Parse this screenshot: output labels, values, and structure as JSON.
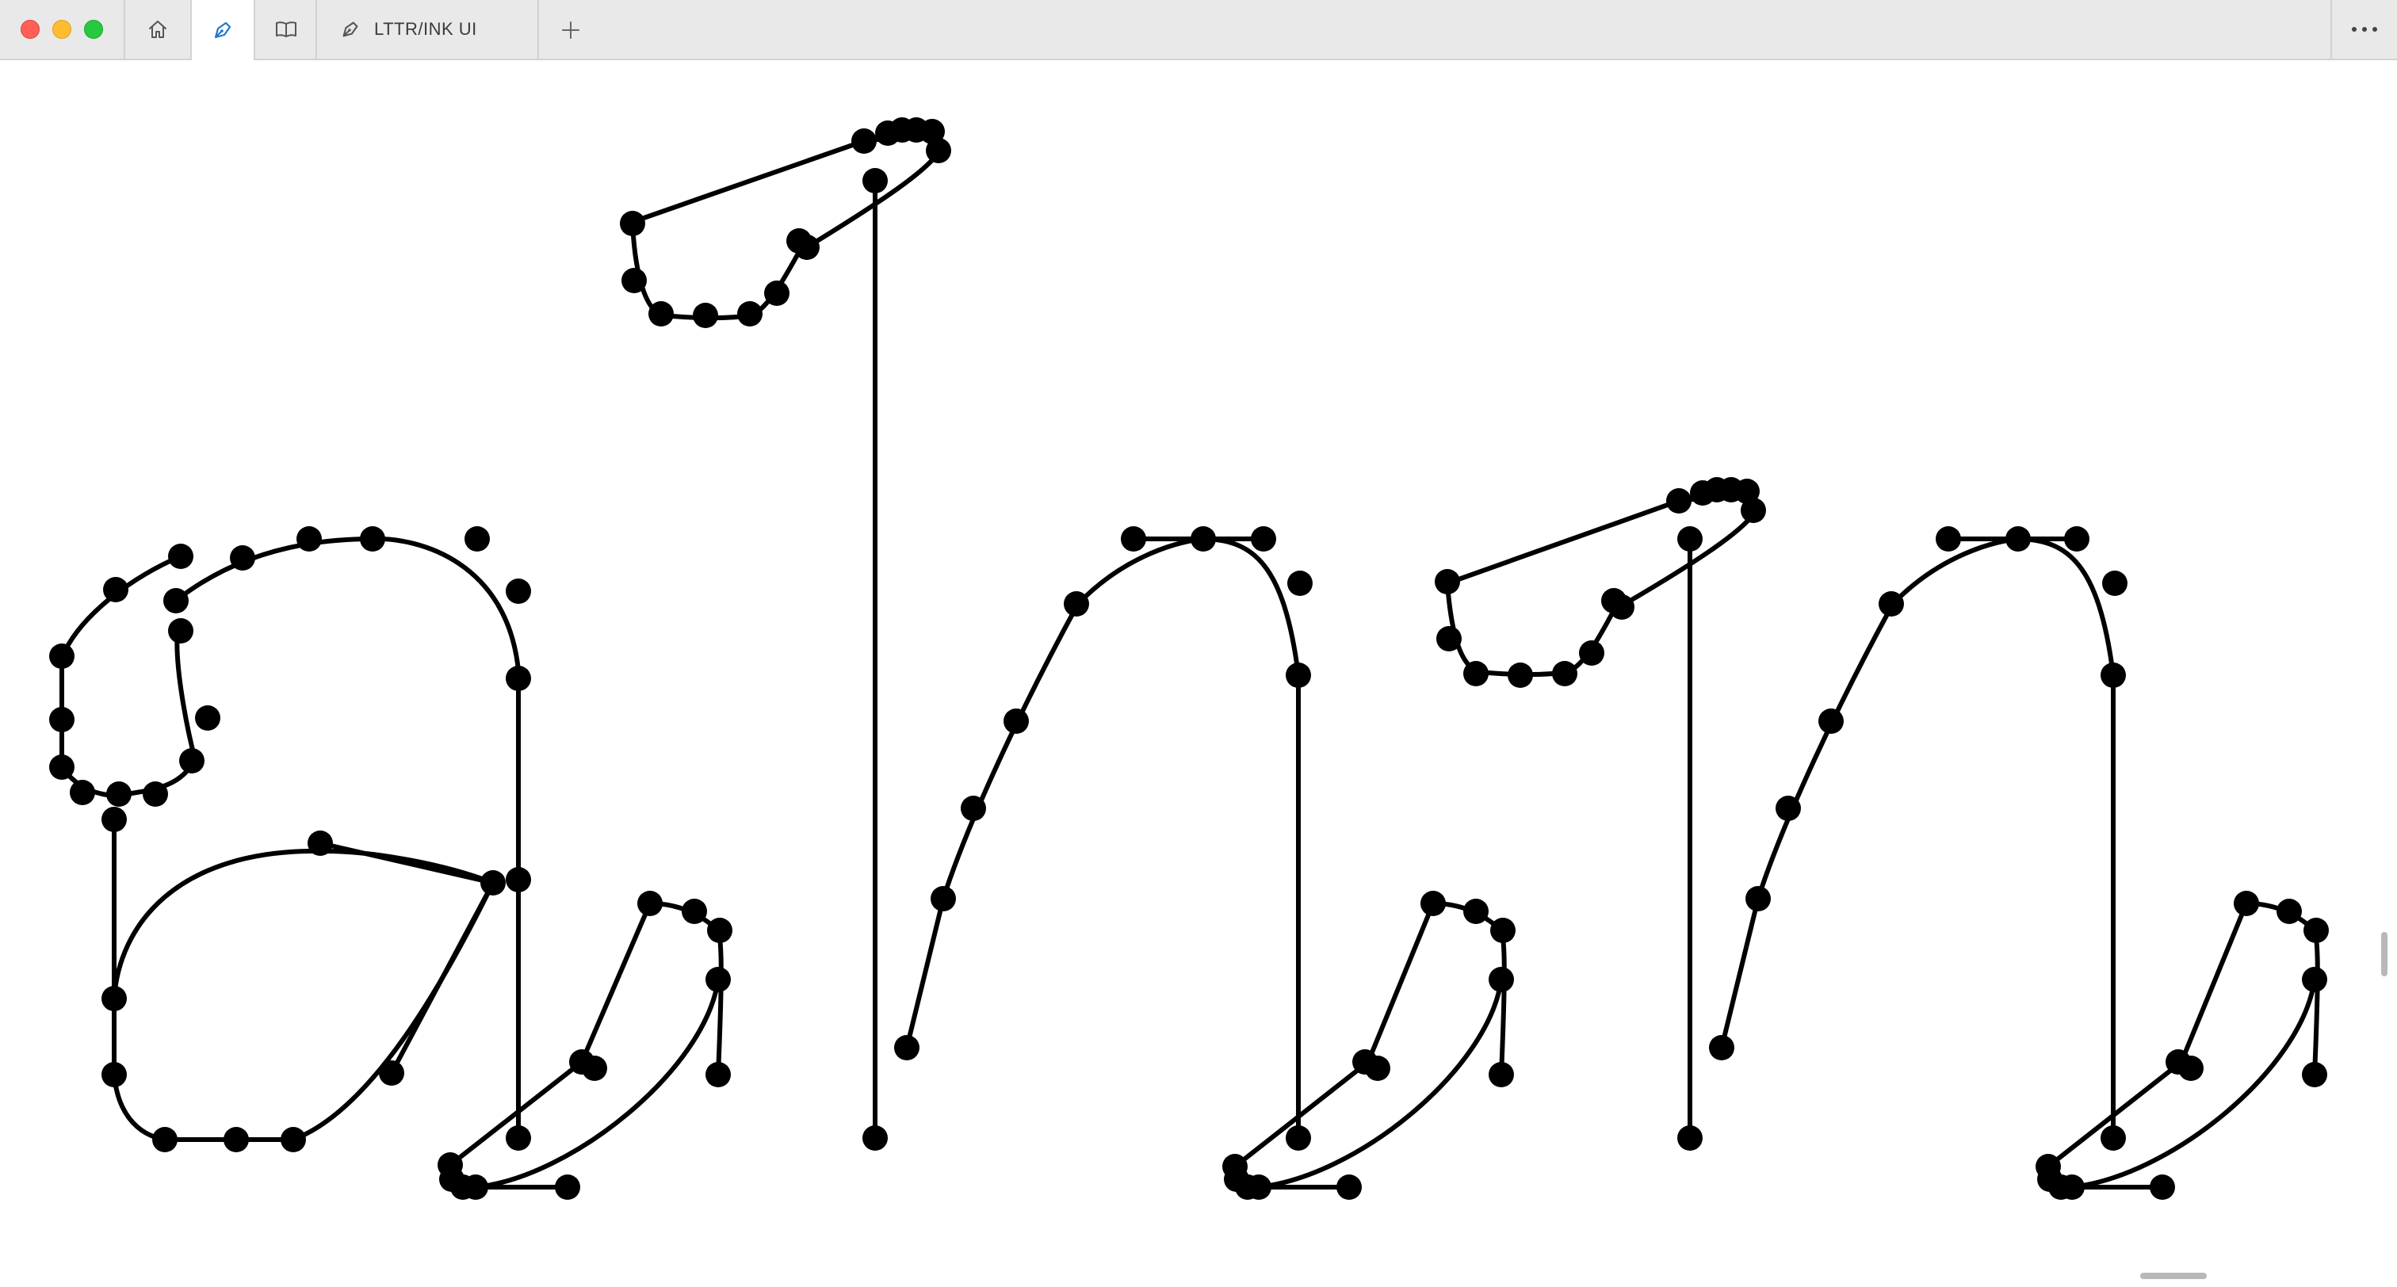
{
  "window": {
    "traffic_lights": [
      "close",
      "minimize",
      "maximize"
    ]
  },
  "tabs": [
    {
      "icon": "home-icon",
      "label": ""
    },
    {
      "icon": "pen-nib-icon",
      "label": "",
      "active": true
    },
    {
      "icon": "book-icon",
      "label": ""
    },
    {
      "icon": "pen-nib-icon",
      "label": "LTTR/INK UI"
    }
  ],
  "toolbar": {
    "new_tab_icon": "plus-icon",
    "more_icon": "ellipsis-icon"
  },
  "colors": {
    "stroke": "#000000",
    "titlebar": "#e9e9e9",
    "accent": "#1f78d1"
  }
}
